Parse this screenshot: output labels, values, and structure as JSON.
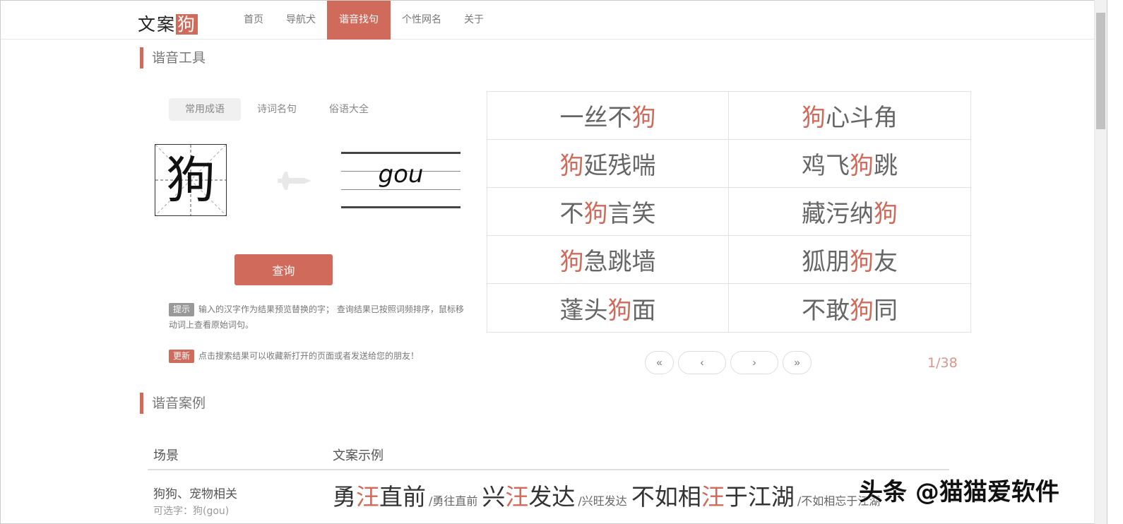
{
  "logo": {
    "text": "文案",
    "highlight": "狗"
  },
  "nav": [
    {
      "label": "首页"
    },
    {
      "label": "导航犬"
    },
    {
      "label": "谐音找句"
    },
    {
      "label": "个性网名"
    },
    {
      "label": "关于"
    }
  ],
  "tool": {
    "title": "谐音工具",
    "tabs": [
      {
        "label": "常用成语"
      },
      {
        "label": "诗词名句"
      },
      {
        "label": "俗语大全"
      }
    ],
    "character": "狗",
    "pinyin": "gou",
    "query_label": "查询",
    "tip_badge": "提示",
    "tip_text": "输入的汉字作为结果预览替换的字； 查询结果已按照词频排序，鼠标移动词上查看原始词句。",
    "update_badge": "更新",
    "update_text": "点击搜索结果可以收藏新打开的页面或者发送给您的朋友！"
  },
  "results": [
    {
      "pre": "一丝不",
      "hl": "狗",
      "post": ""
    },
    {
      "pre": "",
      "hl": "狗",
      "post": "心斗角"
    },
    {
      "pre": "",
      "hl": "狗",
      "post": "延残喘"
    },
    {
      "pre": "鸡飞",
      "hl": "狗",
      "post": "跳"
    },
    {
      "pre": "不",
      "hl": "狗",
      "post": "言笑"
    },
    {
      "pre": "藏污纳",
      "hl": "狗",
      "post": ""
    },
    {
      "pre": "",
      "hl": "狗",
      "post": "急跳墙"
    },
    {
      "pre": "狐朋",
      "hl": "狗",
      "post": "友"
    },
    {
      "pre": "蓬头",
      "hl": "狗",
      "post": "面"
    },
    {
      "pre": "不敢",
      "hl": "狗",
      "post": "同"
    }
  ],
  "pager": {
    "first": "«",
    "prev": "‹",
    "next": "›",
    "last": "»",
    "page": "1/38"
  },
  "cases": {
    "title": "谐音案例",
    "col_scene": "场景",
    "col_example": "文案示例",
    "rows": [
      {
        "scene": "狗狗、宠物相关",
        "sub": "可选字：狗(gou)",
        "examples": [
          {
            "pre": "勇",
            "hl": "汪",
            "post": "直前",
            "orig": "/勇往直前"
          },
          {
            "pre": "兴",
            "hl": "汪",
            "post": "发达",
            "orig": "/兴旺发达"
          },
          {
            "pre": "不如相",
            "hl": "汪",
            "post": "于江湖",
            "orig": "/不如相忘于江湖"
          }
        ]
      }
    ]
  },
  "watermark": "头条 @猫猫爱软件",
  "colors": {
    "accent": "#d06a5a"
  }
}
